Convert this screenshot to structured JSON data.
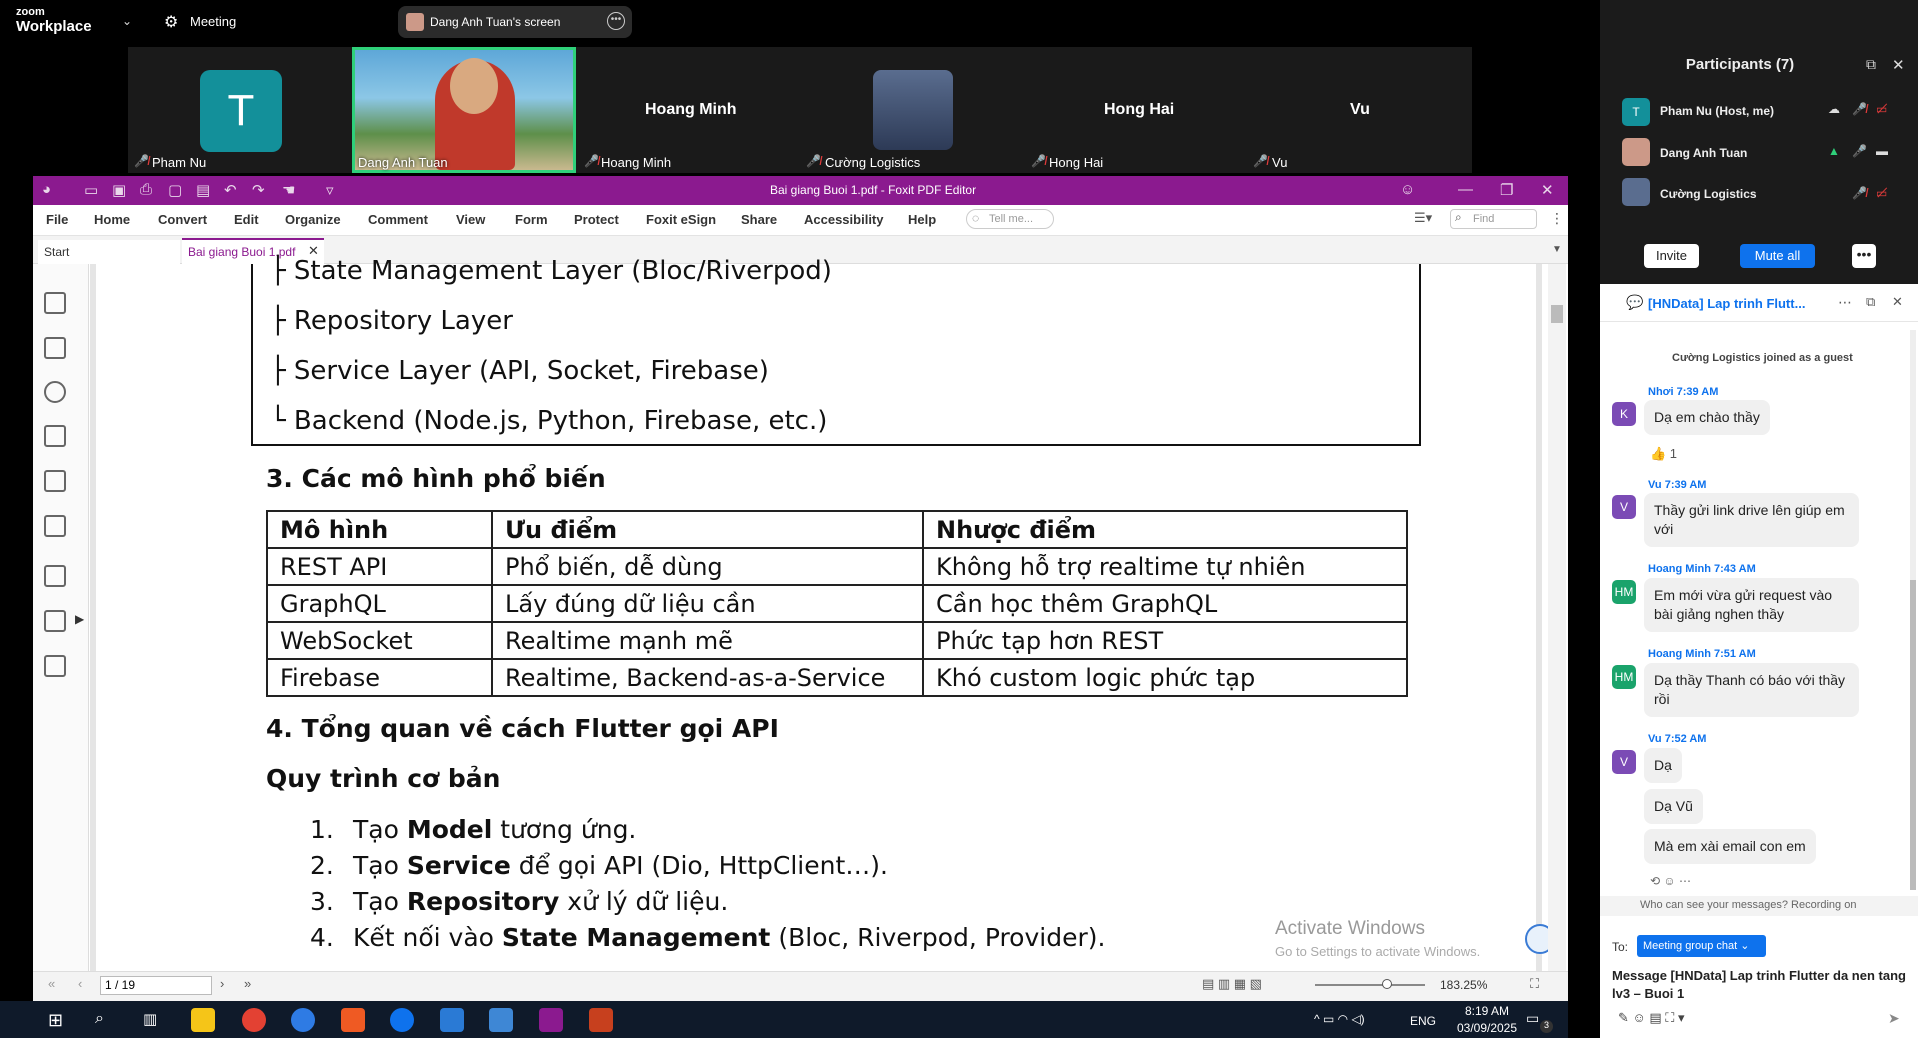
{
  "zoom": {
    "brand_small": "zoom",
    "brand_big": "Workplace",
    "meeting_label": "Meeting",
    "share_label": "Dang Anh Tuan's screen"
  },
  "participants_strip": [
    {
      "name": "Pham Nu",
      "avatar_letter": "T"
    },
    {
      "name": "Dang Anh Tuan"
    },
    {
      "name": "Hoang Minh",
      "big_label": "Hoang Minh"
    },
    {
      "name": "Cường Logistics"
    },
    {
      "name": "Hong Hai",
      "big_label": "Hong Hai"
    },
    {
      "name": "Vu",
      "big_label": "Vu"
    }
  ],
  "foxit": {
    "title": "Bai giang Buoi 1.pdf - Foxit PDF Editor",
    "menu": [
      "File",
      "Home",
      "Convert",
      "Edit",
      "Organize",
      "Comment",
      "View",
      "Form",
      "Protect",
      "Foxit eSign",
      "Share",
      "Accessibility",
      "Help"
    ],
    "tell_me_placeholder": "Tell me...",
    "find_placeholder": "Find",
    "tabs": {
      "start": "Start",
      "active": "Bai giang Buoi 1.pdf"
    },
    "page_indicator": "1 / 19",
    "zoom_level": "183.25%"
  },
  "document": {
    "tree_lines": [
      "├ State Management Layer (Bloc/Riverpod)",
      "├ Repository Layer",
      "├ Service Layer (API, Socket, Firebase)",
      "└ Backend (Node.js, Python, Firebase, etc.)"
    ],
    "section3": "3. Các mô hình phổ biến",
    "table_headers": [
      "Mô hình",
      "Ưu điểm",
      "Nhược điểm"
    ],
    "table_rows": [
      [
        "REST API",
        "Phổ biến, dễ dùng",
        "Không hỗ trợ realtime tự nhiên"
      ],
      [
        "GraphQL",
        "Lấy đúng dữ liệu cần",
        "Cần học thêm GraphQL"
      ],
      [
        "WebSocket",
        "Realtime mạnh mẽ",
        "Phức tạp hơn REST"
      ],
      [
        "Firebase",
        "Realtime, Backend-as-a-Service",
        "Khó custom logic phức tạp"
      ]
    ],
    "section4": "4. Tổng quan về cách Flutter gọi API",
    "subsection": "Quy trình cơ bản",
    "steps": [
      {
        "num": "1.",
        "pre": "Tạo ",
        "bold": "Model",
        "post": " tương ứng."
      },
      {
        "num": "2.",
        "pre": "Tạo ",
        "bold": "Service",
        "post": " để gọi API (Dio, HttpClient…)."
      },
      {
        "num": "3.",
        "pre": "Tạo ",
        "bold": "Repository",
        "post": " xử lý dữ liệu."
      },
      {
        "num": "4.",
        "pre": "Kết nối vào ",
        "bold": "State Management",
        "post": " (Bloc, Riverpod, Provider)."
      }
    ],
    "activate_title": "Activate Windows",
    "activate_sub": "Go to Settings to activate Windows."
  },
  "taskbar": {
    "lang": "ENG",
    "time": "8:19 AM",
    "date": "03/09/2025",
    "notif_count": "3"
  },
  "participants_panel": {
    "title": "Participants (7)",
    "rows": [
      {
        "name": "Pham Nu (Host, me)",
        "avatar": "T"
      },
      {
        "name": "Dang Anh Tuan"
      },
      {
        "name": "Cường Logistics"
      }
    ],
    "invite": "Invite",
    "mute_all": "Mute all"
  },
  "chat": {
    "title": "[HNData] Lap trinh Flutt...",
    "system_msg": "Cường Logistics joined as a guest",
    "messages": [
      {
        "sender": "Nhơi 7:39 AM",
        "avatar": "K",
        "bubbles": [
          "Dạ em chào thầy"
        ],
        "reaction": "👍 1"
      },
      {
        "sender": "Vu 7:39 AM",
        "avatar": "V",
        "bubbles": [
          "Thầy gửi link drive lên giúp em với"
        ]
      },
      {
        "sender": "Hoang Minh 7:43 AM",
        "avatar": "HM",
        "bubbles": [
          "Em mới vừa gửi request vào bài giảng nghen thầy"
        ]
      },
      {
        "sender": "Hoang Minh 7:51 AM",
        "avatar": "HM",
        "bubbles": [
          "Dạ thầy Thanh có báo với thầy rồi"
        ]
      },
      {
        "sender": "Vu 7:52 AM",
        "avatar": "V",
        "bubbles": [
          "Dạ",
          "Dạ Vũ",
          "Mà em xài email con em"
        ]
      }
    ],
    "privacy_note": "Who can see your messages? Recording on",
    "to_label": "To:",
    "to_target": "Meeting group chat ⌄",
    "message_placeholder": "Message [HNData] Lap trinh Flutter da nen tang lv3 – Buoi 1"
  },
  "colors": {
    "foxit_purple": "#8b1a8f",
    "zoom_blue": "#0e72ed",
    "mic_off_red": "#e03b3b",
    "speaker_green": "#2fd07a"
  }
}
